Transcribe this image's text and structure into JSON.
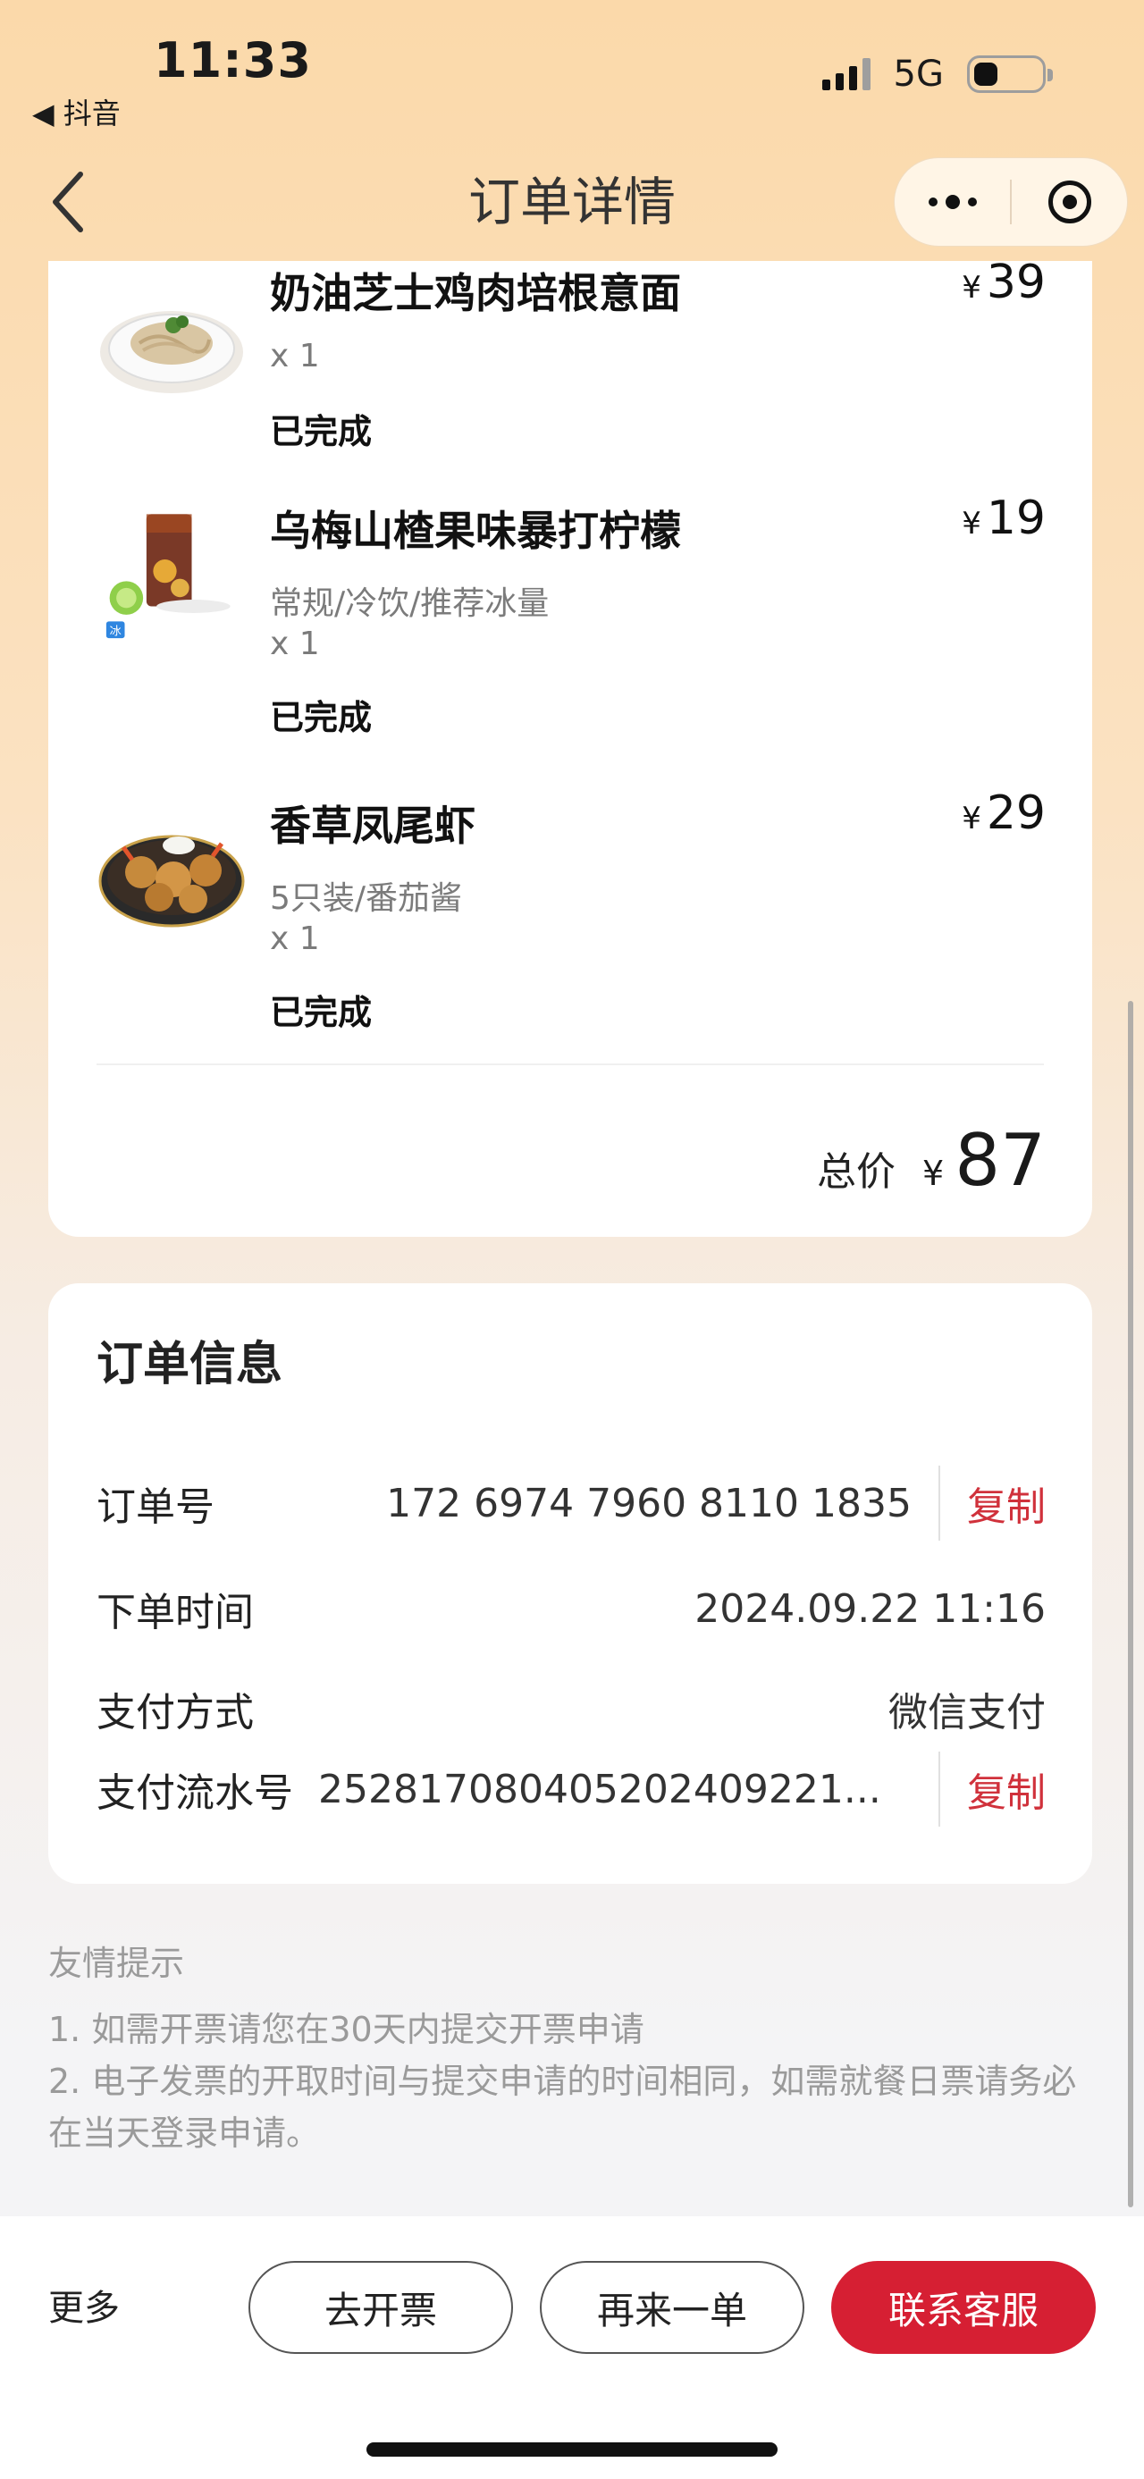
{
  "status_bar": {
    "time": "11:33",
    "back_app": "◀ 抖音",
    "network": "5G"
  },
  "nav": {
    "title": "订单详情"
  },
  "items": [
    {
      "name": "奶油芝士鸡肉培根意面",
      "spec": "",
      "qty": "x 1",
      "status": "已完成",
      "currency": "¥",
      "price": "39"
    },
    {
      "name": "乌梅山楂果味暴打柠檬",
      "spec": "常规/冷饮/推荐冰量",
      "qty": "x 1",
      "status": "已完成",
      "currency": "¥",
      "price": "19",
      "badge": "冰"
    },
    {
      "name": "香草凤尾虾",
      "spec": "5只装/番茄酱",
      "qty": "x 1",
      "status": "已完成",
      "currency": "¥",
      "price": "29"
    }
  ],
  "total": {
    "label": "总价",
    "currency": "¥",
    "value": "87"
  },
  "order_info": {
    "title": "订单信息",
    "order_no_label": "订单号",
    "order_no": "172 6974 7960 8110 1835",
    "copy_label": "复制",
    "time_label": "下单时间",
    "time": "2024.09.22 11:16",
    "pay_method_label": "支付方式",
    "pay_method": "微信支付",
    "pay_serial_label": "支付流水号",
    "pay_serial": "252817080405202409221..."
  },
  "tips": {
    "title": "友情提示",
    "line1": "1. 如需开票请您在30天内提交开票申请",
    "line2": "2. 电子发票的开取时间与提交申请的时间相同，如需就餐日票请务必在当天登录申请。"
  },
  "bottom": {
    "more": "更多",
    "invoice": "去开票",
    "reorder": "再来一单",
    "contact": "联系客服"
  },
  "colors": {
    "accent": "#d61f33",
    "copy": "#d0313b"
  }
}
